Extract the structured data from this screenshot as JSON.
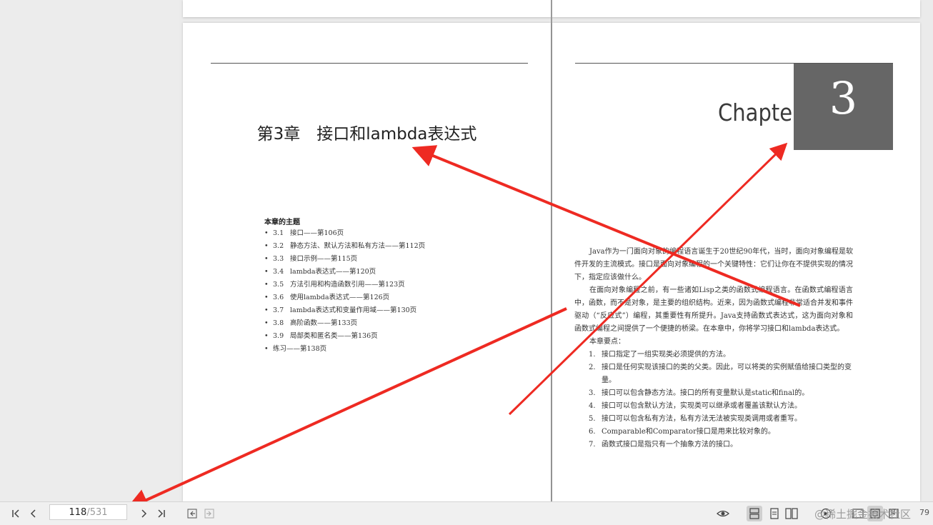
{
  "viewer": {
    "current_page": "118",
    "total_pages": "/531",
    "zoom_fragment": "79",
    "watermark": "@稀土掘金技术社区",
    "icons": {
      "first_page": "first-page-icon",
      "prev_page": "prev-page-icon",
      "next_page": "next-page-icon",
      "last_page": "last-page-icon",
      "back": "back-icon",
      "forward": "forward-icon",
      "read_mode": "eye-icon",
      "continuous": "continuous-scroll-icon",
      "single": "single-page-icon",
      "two_page": "two-page-icon"
    }
  },
  "left_page": {
    "chapter_title": "第3章　接口和lambda表达式",
    "toc_heading": "本章的主题",
    "toc": [
      {
        "num": "3.1",
        "text": "接口——第106页"
      },
      {
        "num": "3.2",
        "text": "静态方法、默认方法和私有方法——第112页"
      },
      {
        "num": "3.3",
        "text": "接口示例——第115页"
      },
      {
        "num": "3.4",
        "text": "lambda表达式——第120页"
      },
      {
        "num": "3.5",
        "text": "方法引用和构造函数引用——第123页"
      },
      {
        "num": "3.6",
        "text": "使用lambda表达式——第126页"
      },
      {
        "num": "3.7",
        "text": "lambda表达式和变量作用域——第130页"
      },
      {
        "num": "3.8",
        "text": "高阶函数——第133页"
      },
      {
        "num": "3.9",
        "text": "局部类和匿名类——第136页"
      },
      {
        "num": "",
        "text": "练习——第138页"
      }
    ]
  },
  "right_page": {
    "chapter_word": "Chapter",
    "chapter_number": "3",
    "para1": "Java作为一门面向对象的编程语言诞生于20世纪90年代，当时，面向对象编程是软件开发的主流模式。接口是面向对象编程的一个关键特性：它们让你在不提供实现的情况下，指定应该做什么。",
    "para2": "在面向对象编程之前，有一些诸如Lisp之类的函数式编程语言。在函数式编程语言中，函数，而不是对象，是主要的组织结构。近来，因为函数式编程非常适合并发和事件驱动（“反应式”）编程，其重要性有所提升。Java支持函数式表达式，这为面向对象和函数式编程之间提供了一个便捷的桥梁。在本章中，你将学习接口和lambda表达式。",
    "points_label": "本章要点：",
    "points": [
      "接口指定了一组实现类必须提供的方法。",
      "接口是任何实现该接口的类的父类。因此，可以将类的实例赋值给接口类型的变量。",
      "接口可以包含静态方法。接口的所有变量默认是static和final的。",
      "接口可以包含默认方法，实现类可以继承或者覆盖该默认方法。",
      "接口可以包含私有方法，私有方法无法被实现类调用或者重写。",
      "Comparable和Comparator接口是用来比较对象的。",
      "函数式接口是指只有一个抽象方法的接口。"
    ]
  },
  "annotations": {
    "color": "#ee2a22"
  }
}
